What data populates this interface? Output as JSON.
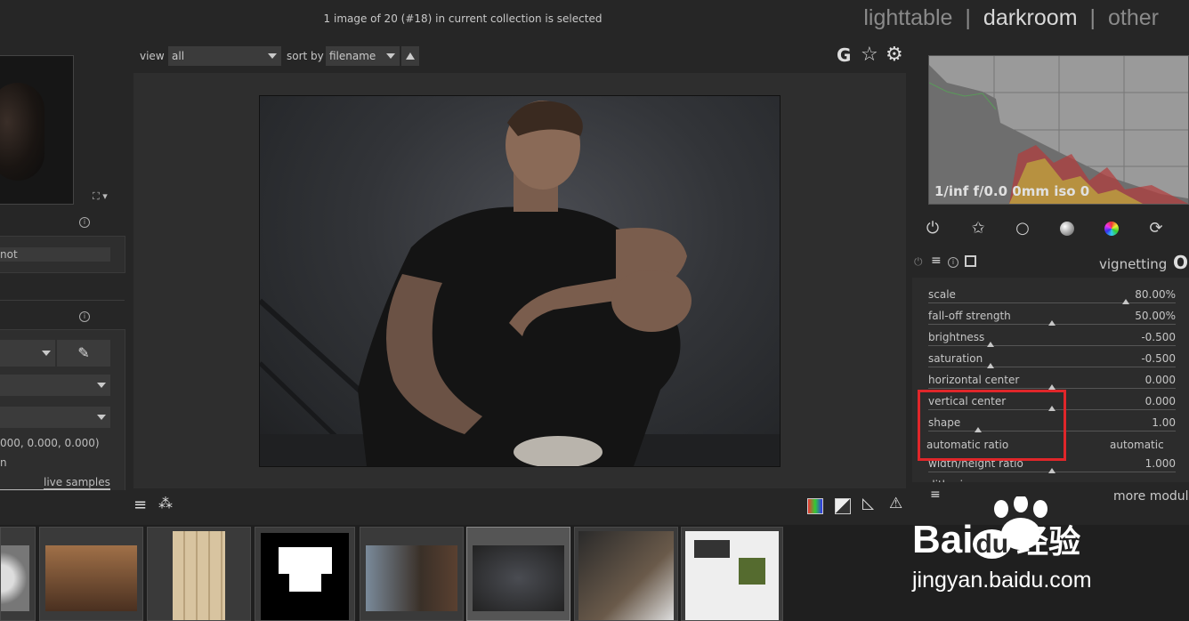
{
  "header": {
    "status": "1 image of 20 (#18) in current collection is selected",
    "views": [
      {
        "label": "lighttable",
        "active": false
      },
      {
        "label": "darkroom",
        "active": true
      },
      {
        "label": "other",
        "active": false
      }
    ],
    "separator": "|"
  },
  "toolbar": {
    "view_label": "view",
    "view_value": "all",
    "sort_label": "sort by",
    "sort_value": "filename",
    "sort_dir_icon": "triangle-up",
    "icons": [
      "grouping-G-icon",
      "star-icon",
      "gear-icon"
    ],
    "grouping_letter": "G"
  },
  "left_panel": {
    "snapshot_text": "not",
    "color_values": "000, 0.000, 0.000)",
    "row_text": "n",
    "live_samples": "live samples"
  },
  "histogram": {
    "exif": "1/inf f/0.0 0mm iso 0"
  },
  "module_groups": [
    "power-icon",
    "star-outline-icon",
    "circle-icon",
    "gradient-circle-icon",
    "color-circle-icon",
    "refresh-icon"
  ],
  "module": {
    "name": "vignetting",
    "sliders": [
      {
        "label": "scale",
        "value": "80.00%",
        "pos": 0.8
      },
      {
        "label": "fall-off strength",
        "value": "50.00%",
        "pos": 0.5
      },
      {
        "label": "brightness",
        "value": "-0.500",
        "pos": 0.25
      },
      {
        "label": "saturation",
        "value": "-0.500",
        "pos": 0.25
      },
      {
        "label": "horizontal center",
        "value": "0.000",
        "pos": 0.5
      },
      {
        "label": "vertical center",
        "value": "0.000",
        "pos": 0.5
      },
      {
        "label": "shape",
        "value": "1.00",
        "pos": 0.2
      }
    ],
    "automatic_ratio_label": "automatic ratio",
    "automatic_ratio_value": "automatic",
    "wh_ratio_label": "width/height ratio",
    "wh_ratio_value": "1.000",
    "wh_ratio_pos": 0.5,
    "dithering_label": "dithering"
  },
  "more_modules": "more modul",
  "watermark": {
    "brand": "Bai",
    "brand2": "du",
    "chinese": "经验",
    "url": "jingyan.baidu.com"
  },
  "colors": {
    "highlight": "#e0262a",
    "background": "#262626",
    "panel": "#2c2c2c"
  }
}
